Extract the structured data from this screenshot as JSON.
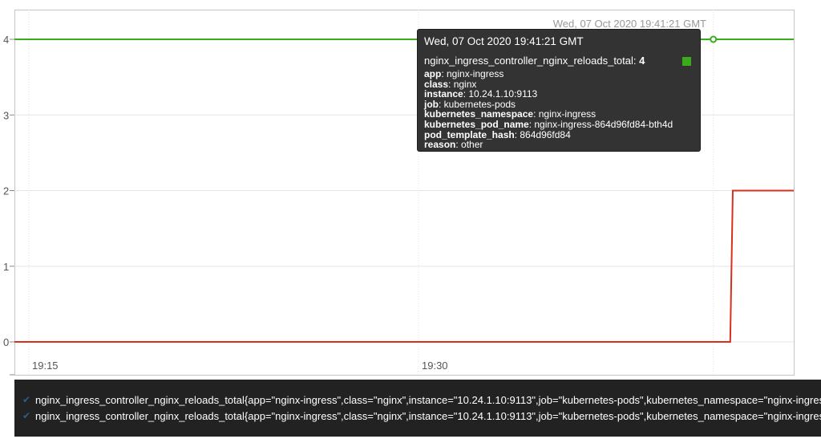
{
  "chart_data": {
    "type": "line",
    "ylim": [
      0,
      4
    ],
    "yticks": [
      0,
      1,
      2,
      3,
      4
    ],
    "xticks": [
      "19:15",
      "19:30"
    ],
    "hover_time": "Wed, 07 Oct 2020 19:41:21 GMT",
    "series": [
      {
        "color": "#3aac1a",
        "points": [
          [
            "19:10:00",
            4
          ],
          [
            "19:45:00",
            4
          ]
        ]
      },
      {
        "color": "#d8301f",
        "points": [
          [
            "19:10:00",
            0
          ],
          [
            "19:42:00",
            0
          ],
          [
            "19:42:06",
            2
          ],
          [
            "19:45:00",
            2
          ]
        ]
      }
    ]
  },
  "tooltip": {
    "time": "Wed, 07 Oct 2020 19:41:21 GMT",
    "series_name": "nginx_ingress_controller_nginx_reloads_total:",
    "series_value": "4",
    "swatch_color": "#3aac1a",
    "labels": [
      {
        "key": "app",
        "value": ": nginx-ingress"
      },
      {
        "key": "class",
        "value": ": nginx"
      },
      {
        "key": "instance",
        "value": ": 10.24.1.10:9113"
      },
      {
        "key": "job",
        "value": ": kubernetes-pods"
      },
      {
        "key": "kubernetes_namespace",
        "value": ": nginx-ingress"
      },
      {
        "key": "kubernetes_pod_name",
        "value": ": nginx-ingress-864d96fd84-bth4d"
      },
      {
        "key": "pod_template_hash",
        "value": ": 864d96fd84"
      },
      {
        "key": "reason",
        "value": ": other"
      }
    ]
  },
  "legend": {
    "items": [
      {
        "color": "#3aac1a",
        "text": "nginx_ingress_controller_nginx_reloads_total{app=\"nginx-ingress\",class=\"nginx\",instance=\"10.24.1.10:9113\",job=\"kubernetes-pods\",kubernetes_namespace=\"nginx-ingress\""
      },
      {
        "color": "#d8301f",
        "text": "nginx_ingress_controller_nginx_reloads_total{app=\"nginx-ingress\",class=\"nginx\",instance=\"10.24.1.10:9113\",job=\"kubernetes-pods\",kubernetes_namespace=\"nginx-ingress\""
      }
    ]
  }
}
